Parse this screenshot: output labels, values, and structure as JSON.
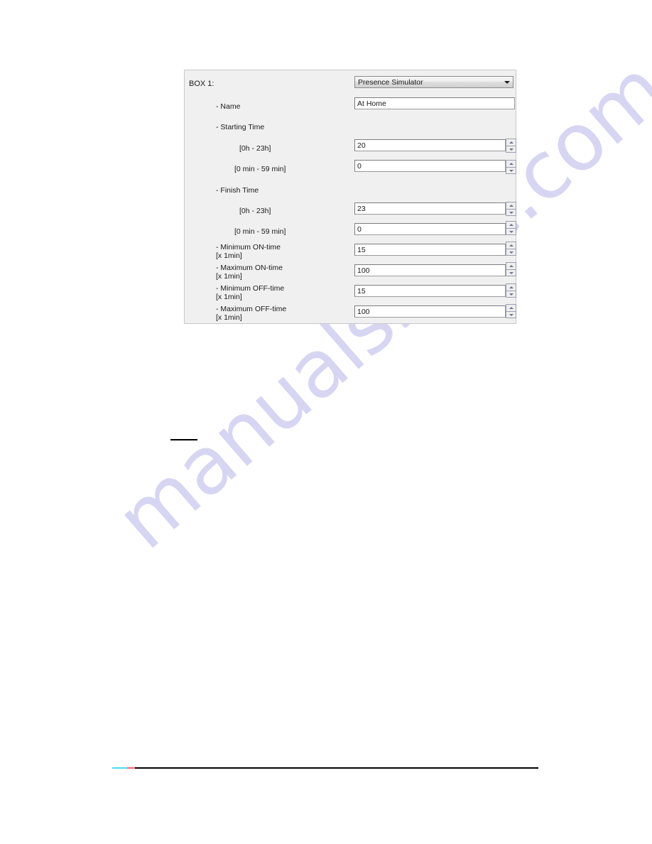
{
  "page": {
    "watermark_text": "manualshive.com",
    "watermark_color": "#c9c9ef"
  },
  "footer_rule": {
    "cyan": "#45e0ee",
    "red": "#f9626e",
    "black": "#000000"
  },
  "dialog": {
    "box_label": "BOX 1:",
    "type_select": {
      "value": "Presence Simulator",
      "arrow_icon": "chevron-down-icon"
    },
    "fields": [
      {
        "label": "- Name",
        "value": "At Home",
        "has_spinner": false
      },
      {
        "label": "- Starting Time",
        "value": "",
        "has_spinner": false,
        "header": true
      },
      {
        "label": "[0h - 23h]",
        "value": "20",
        "has_spinner": true
      },
      {
        "label": "[0 min - 59 min]",
        "value": "0",
        "has_spinner": true
      },
      {
        "label": "- Finish Time",
        "value": "",
        "has_spinner": false,
        "header": true
      },
      {
        "label": "[0h - 23h]",
        "value": "23",
        "has_spinner": true
      },
      {
        "label": "[0 min - 59 min]",
        "value": "0",
        "has_spinner": true
      },
      {
        "label": "- Minimum ON-time\n[x 1min]",
        "value": "15",
        "has_spinner": true
      },
      {
        "label": "- Maximum ON-time\n[x 1min]",
        "value": "100",
        "has_spinner": true
      },
      {
        "label": "- Minimum OFF-time\n[x 1min]",
        "value": "15",
        "has_spinner": true
      },
      {
        "label": "- Maximum OFF-time\n[x 1min]",
        "value": "100",
        "has_spinner": true
      }
    ]
  }
}
